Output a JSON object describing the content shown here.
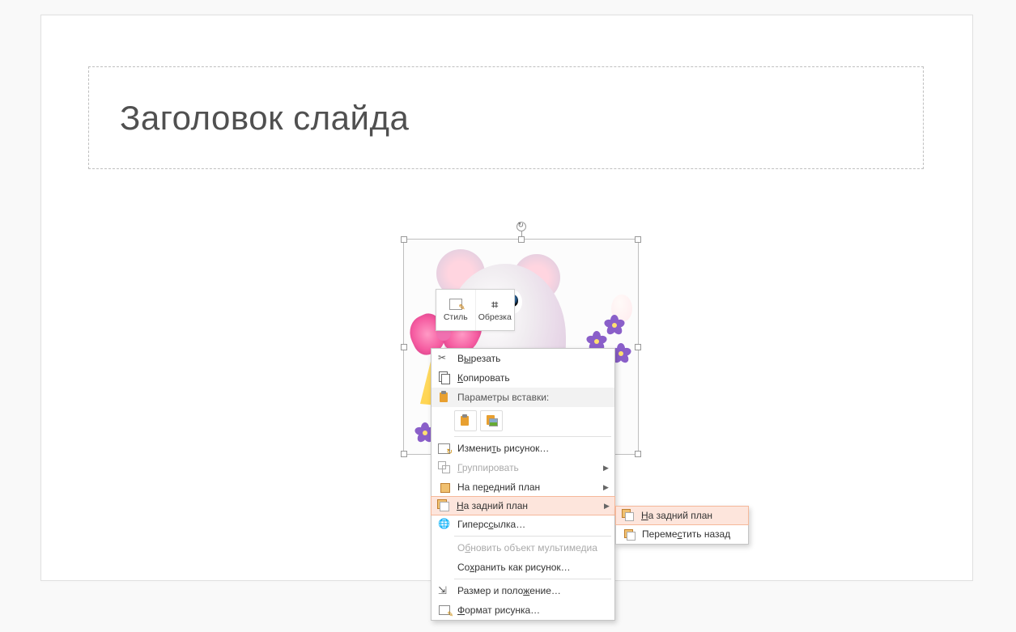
{
  "slide": {
    "title_placeholder": "Заголовок слайда"
  },
  "mini_toolbar": {
    "style": "Стиль",
    "crop": "Обрезка"
  },
  "context_menu": {
    "cut": {
      "pre": "В",
      "u": "ы",
      "post": "резать"
    },
    "copy": {
      "pre": "",
      "u": "К",
      "post": "опировать"
    },
    "paste_header": "Параметры вставки:",
    "change_picture": {
      "pre": "Измени",
      "u": "т",
      "post": "ь рисунок…"
    },
    "group": {
      "pre": "",
      "u": "Г",
      "post": "руппировать"
    },
    "bring_front": {
      "pre": "На пе",
      "u": "р",
      "post": "едний план"
    },
    "send_back": {
      "pre": "",
      "u": "Н",
      "post": "а задний план"
    },
    "hyperlink": {
      "pre": "Гиперс",
      "u": "с",
      "post": "ылка…"
    },
    "update_media": {
      "pre": "О",
      "u": "б",
      "post": "новить объект мультимедиа"
    },
    "save_as_picture": {
      "pre": "Со",
      "u": "х",
      "post": "ранить как рисунок…"
    },
    "size_position": {
      "pre": "Размер и поло",
      "u": "ж",
      "post": "ение…"
    },
    "format_picture": {
      "pre": "",
      "u": "Ф",
      "post": "ормат рисунка…"
    }
  },
  "submenu": {
    "send_to_back": {
      "pre": "",
      "u": "Н",
      "post": "а задний план"
    },
    "send_backward": {
      "pre": "Переме",
      "u": "с",
      "post": "тить назад"
    }
  }
}
